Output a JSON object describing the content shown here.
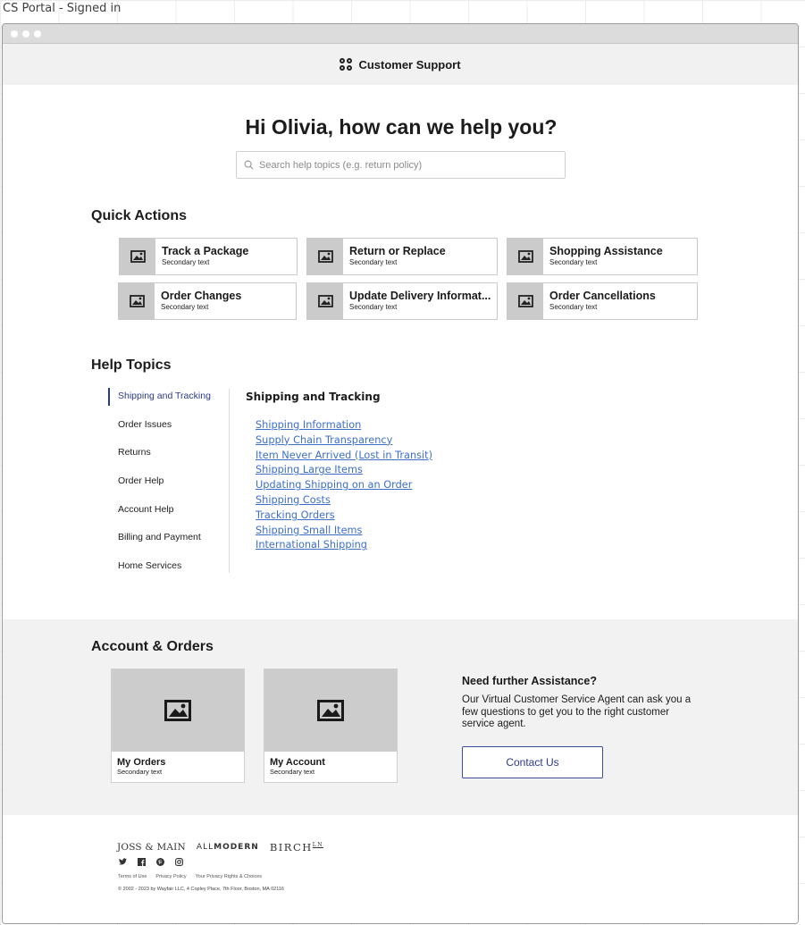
{
  "page_caption": "CS Portal - Signed in",
  "app": {
    "title": "Customer Support"
  },
  "hero": {
    "title": "Hi Olivia, how can we help you?",
    "search_placeholder": "Search help topics (e.g. return policy)"
  },
  "quick_actions": {
    "title": "Quick Actions",
    "items": [
      {
        "label": "Track a Package",
        "secondary": "Secondary text"
      },
      {
        "label": "Return or Replace",
        "secondary": "Secondary text"
      },
      {
        "label": "Shopping Assistance",
        "secondary": "Secondary text"
      },
      {
        "label": "Order Changes",
        "secondary": "Secondary text"
      },
      {
        "label": "Update Delivery Informat...",
        "secondary": "Secondary text"
      },
      {
        "label": "Order Cancellations",
        "secondary": "Secondary text"
      }
    ]
  },
  "help_topics": {
    "title": "Help Topics",
    "categories": [
      {
        "label": "Shipping and Tracking",
        "active": true
      },
      {
        "label": "Order Issues"
      },
      {
        "label": "Returns"
      },
      {
        "label": "Order Help"
      },
      {
        "label": "Account Help"
      },
      {
        "label": "Billing and Payment"
      },
      {
        "label": "Home Services"
      }
    ],
    "selected_heading": "Shipping and Tracking",
    "links": [
      "Shipping Information",
      "Supply Chain Transparency",
      "Item Never Arrived (Lost in Transit)",
      "Shipping Large Items",
      "Updating Shipping on an Order",
      "Shipping Costs",
      "Tracking Orders",
      "Shipping Small Items",
      "International Shipping"
    ]
  },
  "account_orders": {
    "title": "Account & Orders",
    "cards": [
      {
        "label": "My Orders",
        "secondary": "Secondary text"
      },
      {
        "label": "My Account",
        "secondary": "Secondary text"
      }
    ]
  },
  "assistance": {
    "title": "Need further Assistance?",
    "body": "Our Virtual Customer Service Agent can ask you a few questions to get you to the right customer service agent.",
    "button": "Contact Us"
  },
  "footer": {
    "brands": {
      "joss": "JOSS & MAIN",
      "allmodern_a": "ALL",
      "allmodern_b": "MODERN",
      "birch": "BIRCH",
      "birch_sup": "LN"
    },
    "socials": [
      "twitter-icon",
      "facebook-icon",
      "pinterest-icon",
      "instagram-icon"
    ],
    "links": [
      "Terms of Use",
      "Privacy Policy",
      "Your Privacy Rights & Choices"
    ],
    "copyright": "© 2002 - 2023 by Wayfair LLC, 4 Copley Place, 7th Floor, Boston, MA 02116"
  },
  "colors": {
    "accent": "#2a3a8c",
    "link": "#3d6fc8",
    "placeholder": "#cbcbcb"
  }
}
